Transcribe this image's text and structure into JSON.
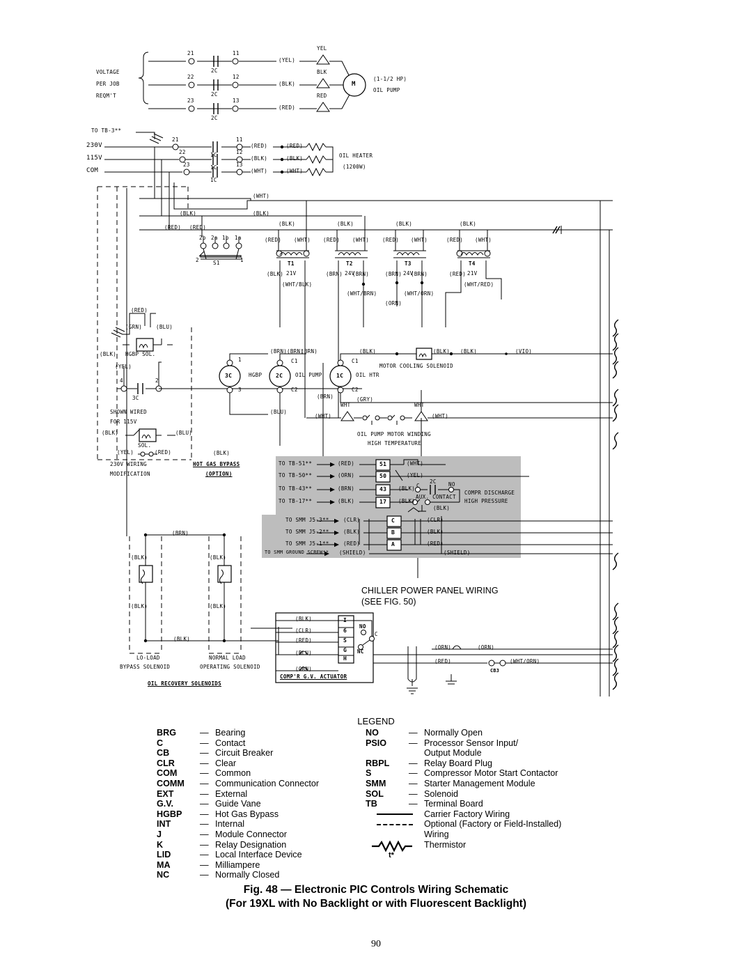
{
  "document": {
    "page_number": "90",
    "caption_line1": "Fig. 48 — Electronic PIC Controls Wiring Schematic",
    "caption_line2": "(For 19XL with No Backlight or with Fluorescent Backlight)"
  },
  "legend": {
    "title": "LEGEND",
    "left_items": [
      {
        "abbr": "BRG",
        "dash": "—",
        "desc": "Bearing"
      },
      {
        "abbr": "C",
        "dash": "—",
        "desc": "Contact"
      },
      {
        "abbr": "CB",
        "dash": "—",
        "desc": "Circuit Breaker"
      },
      {
        "abbr": "CLR",
        "dash": "—",
        "desc": "Clear"
      },
      {
        "abbr": "COM",
        "dash": "—",
        "desc": "Common"
      },
      {
        "abbr": "COMM",
        "dash": "—",
        "desc": "Communication Connector"
      },
      {
        "abbr": "EXT",
        "dash": "—",
        "desc": "External"
      },
      {
        "abbr": "G.V.",
        "dash": "—",
        "desc": "Guide Vane"
      },
      {
        "abbr": "HGBP",
        "dash": "—",
        "desc": "Hot Gas Bypass"
      },
      {
        "abbr": "INT",
        "dash": "—",
        "desc": "Internal"
      },
      {
        "abbr": "J",
        "dash": "—",
        "desc": "Module Connector"
      },
      {
        "abbr": "K",
        "dash": "—",
        "desc": "Relay Designation"
      },
      {
        "abbr": "LID",
        "dash": "—",
        "desc": "Local Interface Device"
      },
      {
        "abbr": "MA",
        "dash": "—",
        "desc": "Milliampere"
      },
      {
        "abbr": "NC",
        "dash": "—",
        "desc": "Normally Closed"
      }
    ],
    "right_items": [
      {
        "abbr": "NO",
        "dash": "—",
        "desc": "Normally Open"
      },
      {
        "abbr": "PSIO",
        "dash": "—",
        "desc": "Processor Sensor Input/"
      },
      {
        "abbr": "",
        "dash": "",
        "desc": "Output Module",
        "continuation": true
      },
      {
        "abbr": "RBPL",
        "dash": "—",
        "desc": "Relay Board Plug"
      },
      {
        "abbr": "S",
        "dash": "—",
        "desc": "Compressor Motor Start Contactor"
      },
      {
        "abbr": "SMM",
        "dash": "—",
        "desc": "Starter Management Module"
      },
      {
        "abbr": "SOL",
        "dash": "—",
        "desc": "Solenoid"
      },
      {
        "abbr": "TB",
        "dash": "—",
        "desc": "Terminal Board"
      }
    ],
    "symbol_items": [
      {
        "symbol": "solid-line",
        "desc": "Carrier Factory Wiring"
      },
      {
        "symbol": "dashed-line",
        "desc": "Optional (Factory or Field-Installed)"
      },
      {
        "symbol": "",
        "desc": "Wiring",
        "continuation": true
      },
      {
        "symbol": "thermistor",
        "desc": "Thermistor",
        "sublabel": "t*"
      }
    ]
  },
  "schematic": {
    "power_section": {
      "voltage_note": [
        "VOLTAGE",
        "PER JOB",
        "REQM'T"
      ],
      "top_terminals": [
        "21",
        "22",
        "23"
      ],
      "mid_terminals": [
        "11",
        "12",
        "13"
      ],
      "contacts": [
        "2C",
        "2C",
        "2C"
      ],
      "wire_colors": [
        "(YEL)",
        "(BLK)",
        "(RED)"
      ],
      "lead_labels": [
        "YEL",
        "BLK",
        "RED"
      ],
      "motor_symbol": "M",
      "motor_label_line1": "(1-1/2 HP)",
      "motor_label_line2": "OIL PUMP"
    },
    "heater_section": {
      "to_tb": "TO TB-3**",
      "rails": [
        "230V",
        "115V",
        "COM"
      ],
      "top_terminals": [
        "21",
        "22",
        "23"
      ],
      "mid_terminals": [
        "11",
        "12",
        "13"
      ],
      "contacts": [
        "1C",
        "1C",
        "1C"
      ],
      "wire_colors_a": [
        "(RED)",
        "(BLK)",
        "(WHT)"
      ],
      "wire_colors_b": [
        "(RED)",
        "(BLK)",
        "(WHT)"
      ],
      "heater_label_line1": "OIL HEATER",
      "heater_label_line2": "(1200W)"
    },
    "bus_labels": {
      "wht": "(WHT)",
      "blk": "(BLK)",
      "red": "(RED)",
      "blk2": "(BLK)",
      "red2": "(RED)"
    },
    "switch": {
      "poles": [
        "2b",
        "2a",
        "1b",
        "1a"
      ],
      "name": "S1",
      "pos_left": "2",
      "pos_right": "1"
    },
    "transformers": [
      {
        "name": "T1",
        "volts": "21V",
        "pri_left": "(RED)",
        "pri_right": "(WHT)",
        "sec_left": "(BLK)",
        "sec_right": "(WHT/BLK)",
        "top": "(BLK)"
      },
      {
        "name": "T2",
        "volts": "24V",
        "pri_left": "(RED)",
        "pri_right": "(WHT)",
        "sec_left": "(BRN)",
        "sec_right": "(BRN)",
        "sec_tap": "(WHT/BRN)",
        "top": "(BLK)"
      },
      {
        "name": "T3",
        "volts": "24V",
        "pri_left": "(RED)",
        "pri_right": "(WHT)",
        "sec_left": "(BRN)",
        "sec_right": "(BRN)",
        "sec_tap": "(ORN)",
        "sec_tap2": "(WHT/ORN)",
        "top": "(BLK)"
      },
      {
        "name": "T4",
        "volts": "21V",
        "pri_left": "(RED)",
        "pri_right": "(WHT)",
        "sec_left": "(RED)",
        "sec_right": "(WHT/RED)",
        "top": "(BLK)"
      }
    ],
    "hgbp_block": {
      "red": "(RED)",
      "grn": "(GRN)",
      "blu": "(BLU)",
      "blk": "(BLK)",
      "sol_label": "HGBP SOL.",
      "yel": "(YEL)",
      "contact_left": "4",
      "contact_right": "2",
      "contact_name": "3C",
      "note_line1": "SHOWN WIRED",
      "note_line2": "FOR 115V",
      "mod_blk": "(BLK)",
      "mod_blu": "(BLU)",
      "mod_sol": "SOL.",
      "mod_yel": "(YEL)",
      "mod_red": "(RED)",
      "mod_note1": "230V WIRING",
      "mod_note2": "MODIFICATION",
      "option_title1": "HOT GAS BYPASS",
      "option_title2": "(OPTION)",
      "coil_name": "3C",
      "coil_label": "HGBP",
      "coil_t1": "1",
      "coil_t3": "3",
      "coil_brn": "(BRN)",
      "coil_blu": "(BLU)"
    },
    "relay_row": {
      "oil_pump": {
        "coil": "2C",
        "label": "OIL PUMP",
        "c1": "C1",
        "c2": "C2",
        "brn": "(BRN)"
      },
      "oil_htr": {
        "coil": "1C",
        "label": "OIL HTR",
        "c1": "C1",
        "c2": "C2",
        "brn": "(BRN)",
        "gry": "(GRY)"
      },
      "motor_cooling": {
        "label": "MOTOR COOLING SOLENOID",
        "brn": "(BRN)",
        "blk1": "(BLK)",
        "blk2": "(BLK)",
        "blk3": "(BLK)",
        "vio": "(VIO)"
      }
    },
    "oil_pump_winding": {
      "wht_left": "(WHT)",
      "wht_right": "(WHT)",
      "lead_left": "WHT",
      "lead_right": "WHT",
      "label_line1": "OIL PUMP MOTOR WINDING",
      "label_line2": "HIGH TEMPERATURE",
      "blk": "(BLK)"
    },
    "panel_block": {
      "rows": [
        {
          "to": "TO TB-51**",
          "color": "(RED)",
          "term": "51",
          "out": "(WHT)"
        },
        {
          "to": "TO TB-50**",
          "color": "(ORN)",
          "term": "50",
          "out": "(YEL)"
        },
        {
          "to": "TO TB-43**",
          "color": "(BRN)",
          "term": "43",
          "out": "(BLK)"
        },
        {
          "to": "TO TB-17**",
          "color": "(BLK)",
          "term": "17",
          "out": "(BLK)"
        },
        {
          "to": "TO SMM J5-3**",
          "color": "(CLR)",
          "term": "C",
          "out": "(CLR)"
        },
        {
          "to": "TO SMM J5-2**",
          "color": "(BLK)",
          "term": "B",
          "out": "(BLK)"
        },
        {
          "to": "TO SMM J5-1**",
          "color": "(RED)",
          "term": "A",
          "out": "(RED)"
        },
        {
          "to": "TO SMM GROUND SCREW**",
          "color": "(SHIELD)",
          "term": "",
          "out": "(SHIELD)"
        }
      ],
      "aux_contact_label": "AUX. CONTACT",
      "aux_c": "C",
      "aux_2c": "2C",
      "aux_no": "NO",
      "aux_blk_in": "(BLK)",
      "aux_blk_out": "(BLK)",
      "discharge_line1": "COMPR DISCHARGE",
      "discharge_line2": "HIGH PRESSURE",
      "panel_caption_line1": "CHILLER POWER PANEL WIRING",
      "panel_caption_line2": "(SEE FIG. 50)"
    },
    "oil_recovery": {
      "brn": "(BRN)",
      "blk_a": "(BLK)",
      "blk_b": "(BLK)",
      "blk_c": "(BLK)",
      "blk_d": "(BLK)",
      "blk_e": "(BLK)",
      "left_label1": "LO-LOAD",
      "left_label2": "BYPASS SOLENOID",
      "right_label1": "NORMAL LOAD",
      "right_label2": "OPERATING SOLENOID",
      "title": "OIL RECOVERY SOLENOIDS"
    },
    "gv_actuator": {
      "title": "COMP'R G.V. ACTUATOR",
      "terminals": [
        "I",
        "6",
        "S",
        "G",
        "H"
      ],
      "wires": [
        "(BLK)",
        "(CLR)",
        "(RED)",
        "(BLU)",
        "(ORN)"
      ],
      "no": "NO",
      "nc": "NC",
      "c": "C",
      "orn_a": "(ORN)",
      "orn_b": "(ORN)",
      "red": "(RED)",
      "wht_orn": "(WHT/ORN)",
      "cb3": "CB3"
    }
  }
}
